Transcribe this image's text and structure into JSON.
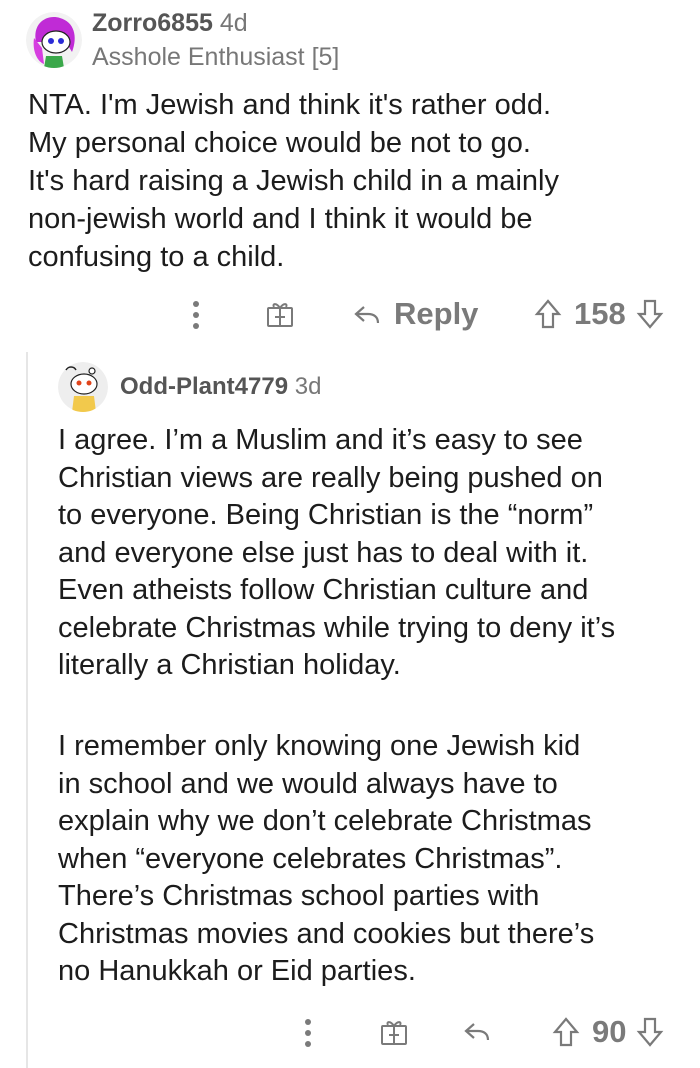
{
  "comments": [
    {
      "username": "Zorro6855",
      "age": "4d",
      "flair": "Asshole Enthusiast [5]",
      "avatar": "snoo-avatar-purple-hair",
      "body": "NTA.  I'm Jewish and think it's rather odd.\nMy personal choice would be not to go.\nIt's hard raising a Jewish child in a mainly\nnon-jewish world and I think it would be\nconfusing to a child.",
      "actions": {
        "reply_label": "Reply",
        "votes": "158"
      }
    },
    {
      "username": "Odd-Plant4779",
      "age": "3d",
      "avatar": "snoo-avatar-default",
      "body_paragraphs": [
        "I agree. I’m a Muslim and it’s easy to see\nChristian views are really being pushed on\nto everyone. Being Christian is the “norm”\nand everyone else just has to deal with it.\nEven atheists follow Christian culture and\ncelebrate Christmas while trying to deny it’s\nliterally a Christian holiday.",
        "I remember only knowing one Jewish kid\nin school and we would always have to\nexplain why we don’t celebrate Christmas\nwhen “everyone celebrates Christmas”.\nThere’s Christmas school parties with\nChristmas movies and cookies but there’s\nno Hanukkah or Eid parties."
      ],
      "actions": {
        "votes": "90"
      }
    }
  ],
  "icons": {
    "more": "more-vertical-icon",
    "award": "gift-award-icon",
    "reply": "reply-arrow-icon",
    "upvote": "upvote-arrow-icon",
    "downvote": "downvote-arrow-icon"
  }
}
